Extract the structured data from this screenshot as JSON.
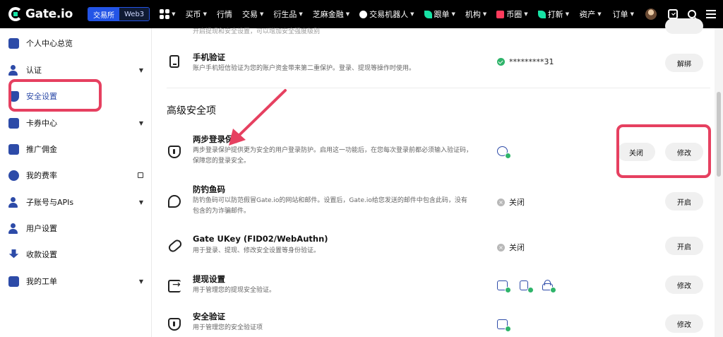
{
  "topbar": {
    "logo": "Gate.io",
    "seg_exchange": "交易所",
    "seg_web3": "Web3",
    "nav": [
      {
        "label": "买币"
      },
      {
        "label": "行情"
      },
      {
        "label": "交易"
      },
      {
        "label": "衍生品"
      },
      {
        "label": "芝麻金融"
      },
      {
        "label": "交易机器人"
      },
      {
        "label": "跟单"
      },
      {
        "label": "机构"
      },
      {
        "label": "币圈"
      },
      {
        "label": "打新"
      }
    ],
    "more": "›",
    "assets": "资产",
    "orders": "订单"
  },
  "sidebar": {
    "items": [
      {
        "label": "个人中心总览"
      },
      {
        "label": "认证"
      },
      {
        "label": "安全设置"
      },
      {
        "label": "卡券中心"
      },
      {
        "label": "推广佣金"
      },
      {
        "label": "我的费率"
      },
      {
        "label": "子账号与APIs"
      },
      {
        "label": "用户设置"
      },
      {
        "label": "收款设置"
      },
      {
        "label": "我的工单"
      }
    ]
  },
  "main": {
    "top_partial_desc": "开启提现和安全设置，可以增加安全强度级别",
    "phone": {
      "title": "手机验证",
      "desc": "账户手机短信验证为您的账户资金带来第二重保护。登录、提现等操作时使用。",
      "status": "*********31",
      "button": "解绑"
    },
    "section_title": "高级安全项",
    "twofa": {
      "title": "两步登录保护",
      "desc": "两步登录保护提供更为安全的用户登录防护。启用这一功能后，在您每次登录前都必须输入验证码，保障您的登录安全。",
      "button_off": "关闭",
      "button_edit": "修改"
    },
    "antiphish": {
      "title": "防钓鱼码",
      "desc": "防钓鱼码可以防范假冒Gate.io的网站和邮件。设置后，Gate.io给您发送的邮件中包含此码，没有包含的为诈骗邮件。",
      "status": "关闭",
      "button": "开启"
    },
    "ukey": {
      "title": "Gate UKey (FID02/WebAuthn)",
      "desc": "用于登录、提现、修改安全设置等身份验证。",
      "status": "关闭",
      "button": "开启"
    },
    "withdraw": {
      "title": "提现设置",
      "desc": "用于管理您的提现安全验证。",
      "button": "修改"
    },
    "secverify": {
      "title": "安全验证",
      "desc": "用于管理您的安全验证项",
      "button": "修改"
    }
  },
  "colors": {
    "accent_blue": "#2354e6",
    "success_green": "#2fb46a",
    "annotation_red": "#e64060"
  }
}
